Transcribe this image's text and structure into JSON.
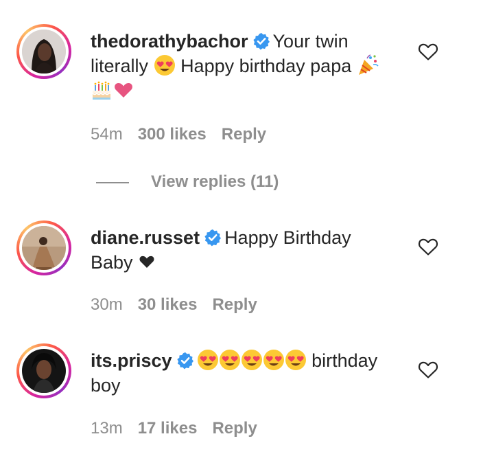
{
  "comments": [
    {
      "username": "thedorathybachor",
      "verified": true,
      "text_a": "Your twin",
      "text_b": "literally",
      "text_c": "Happy birthday papa",
      "time": "54m",
      "likes": "300 likes",
      "reply": "Reply",
      "view_replies": "View replies (11)"
    },
    {
      "username": "diane.russet",
      "verified": true,
      "text_a": "Happy Birthday",
      "text_b": "Baby",
      "time": "30m",
      "likes": "30 likes",
      "reply": "Reply"
    },
    {
      "username": "its.priscy",
      "verified": true,
      "text_a": "birthday",
      "text_b": "boy",
      "time": "13m",
      "likes": "17 likes",
      "reply": "Reply"
    }
  ],
  "colors": {
    "text": "#262626",
    "muted": "#8e8e8e",
    "verified_blue": "#3897f0",
    "heart_pink": "#e75480"
  },
  "icons": [
    "verified-badge-icon",
    "heart-outline-icon",
    "heart-eyes-emoji",
    "party-popper-emoji",
    "birthday-cake-emoji",
    "pink-heart-emoji",
    "black-heart-emoji"
  ]
}
